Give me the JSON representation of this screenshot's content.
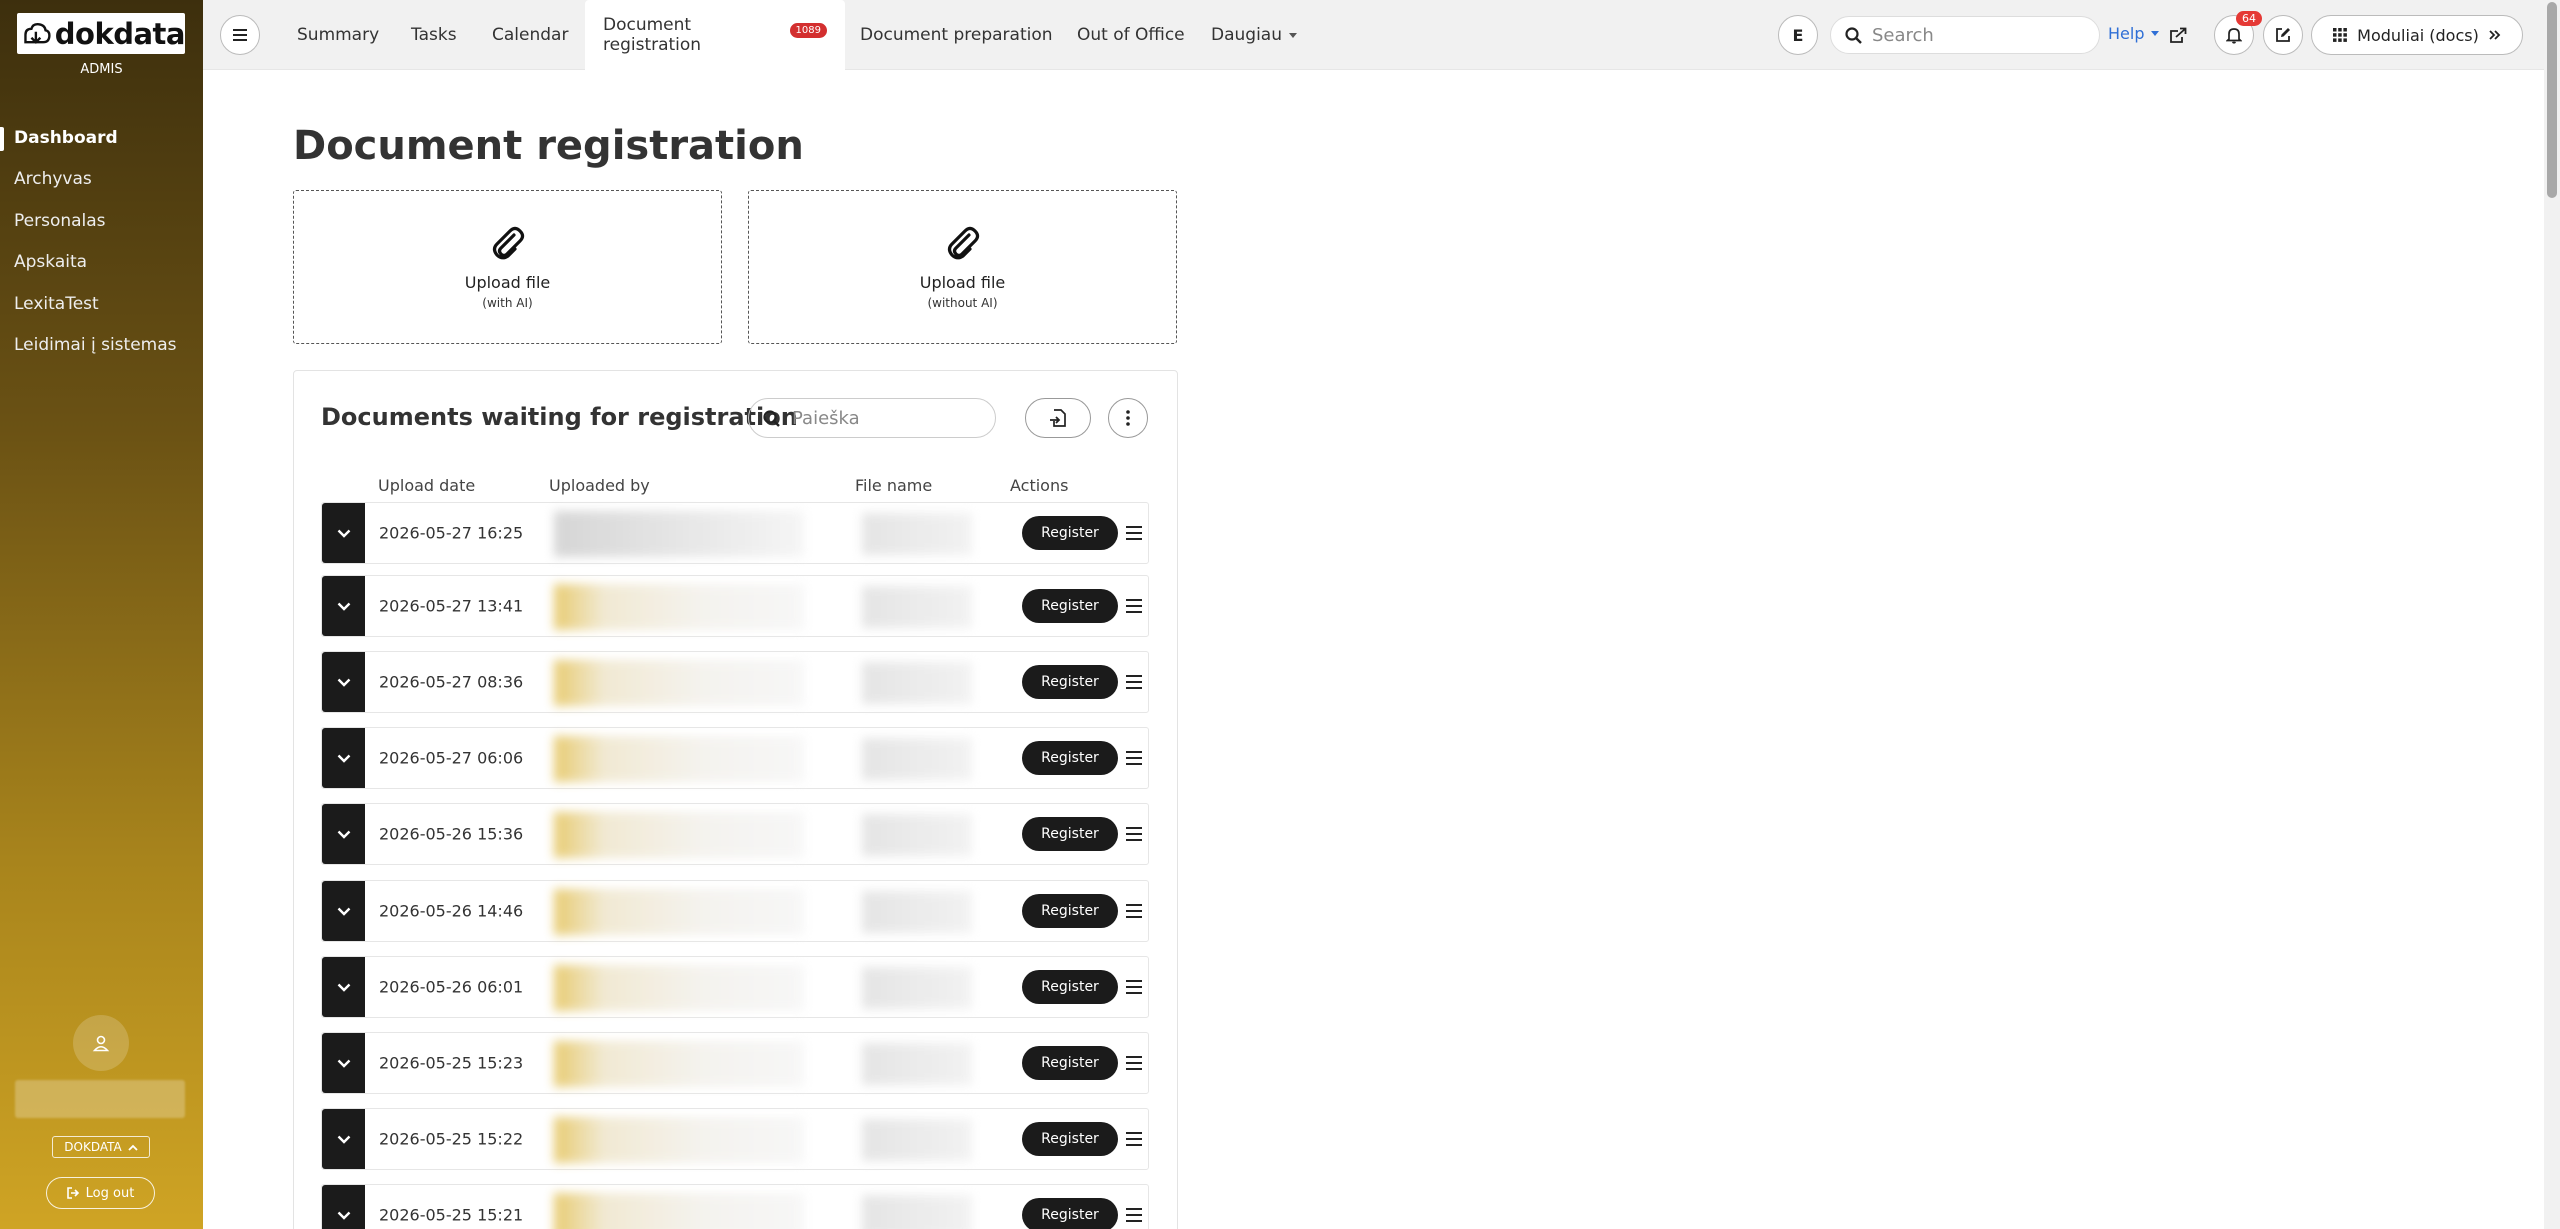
{
  "sidebar": {
    "logo_text": "dokdata",
    "role": "ADMIS",
    "items": [
      {
        "label": "Dashboard",
        "active": true
      },
      {
        "label": "Archyvas",
        "active": false
      },
      {
        "label": "Personalas",
        "active": false
      },
      {
        "label": "Apskaita",
        "active": false
      },
      {
        "label": "LexitaTest",
        "active": false
      },
      {
        "label": "Leidimai į sistemas",
        "active": false
      }
    ],
    "company": "DOKDATA",
    "logout_label": "Log out"
  },
  "topbar": {
    "tabs": [
      {
        "label": "Summary"
      },
      {
        "label": "Tasks"
      },
      {
        "label": "Calendar"
      },
      {
        "label": "Document registration",
        "badge": "1089",
        "active": true
      },
      {
        "label": "Document preparation"
      },
      {
        "label": "Out of Office"
      },
      {
        "label": "Daugiau",
        "dropdown": true
      }
    ],
    "user_initial": "E",
    "search_placeholder": "Search",
    "help_label": "Help",
    "notifications_count": "64",
    "modules_label": "Moduliai (docs)"
  },
  "main": {
    "title": "Document registration",
    "upload_ai": {
      "label": "Upload file",
      "sub": "(with AI)"
    },
    "upload_no_ai": {
      "label": "Upload file",
      "sub": "(without AI)"
    },
    "waiting": {
      "title": "Documents waiting for registration",
      "search_placeholder": "Paieška",
      "columns": {
        "upload_date": "Upload date",
        "uploaded_by": "Uploaded by",
        "file_name": "File name",
        "actions": "Actions"
      },
      "register_label": "Register",
      "rows": [
        {
          "date": "2026-05-27 16:25"
        },
        {
          "date": "2026-05-27 13:41"
        },
        {
          "date": "2026-05-27 08:36"
        },
        {
          "date": "2026-05-27 06:06"
        },
        {
          "date": "2026-05-26 15:36"
        },
        {
          "date": "2026-05-26 14:46"
        },
        {
          "date": "2026-05-26 06:01"
        },
        {
          "date": "2026-05-25 15:23"
        },
        {
          "date": "2026-05-25 15:22"
        },
        {
          "date": "2026-05-25 15:21",
          "uploaded_by_partial": "vytautas.vaitkus@dokdata.lt",
          "file_partial": "Perdavimo-..."
        }
      ]
    }
  },
  "colors": {
    "accent_dark": "#1b1b1b",
    "sidebar_top": "#3d2f0d",
    "sidebar_bottom": "#cfa424",
    "badge_red": "#d32f2f",
    "link_blue": "#2f6fd6"
  }
}
